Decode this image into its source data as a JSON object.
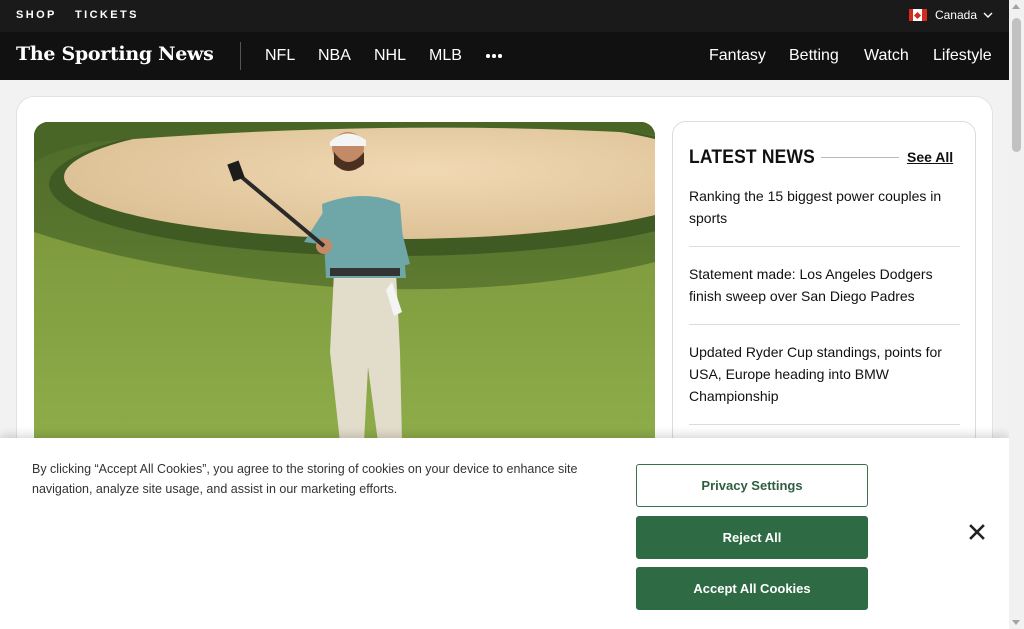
{
  "topbar": {
    "links": [
      "SHOP",
      "TICKETS"
    ],
    "region": "Canada"
  },
  "nav": {
    "logo": "The Sporting News",
    "leagues": [
      "NFL",
      "NBA",
      "NHL",
      "MLB"
    ],
    "sections": [
      "Fantasy",
      "Betting",
      "Watch",
      "Lifestyle"
    ]
  },
  "latest": {
    "title": "LATEST NEWS",
    "see_all": "See All",
    "items": [
      "Ranking the 15 biggest power couples in sports",
      "Statement made: Los Angeles Dodgers finish sweep over San Diego Padres",
      "Updated Ryder Cup standings, points for USA, Europe heading into BMW Championship"
    ]
  },
  "cookie": {
    "text": "By clicking “Accept All Cookies”, you agree to the storing of cookies on your device to enhance site navigation, analyze site usage, and assist in our marketing efforts.",
    "privacy_settings": "Privacy Settings",
    "reject_all": "Reject All",
    "accept_all": "Accept All Cookies"
  },
  "colors": {
    "header": "#1a1a1a",
    "nav": "#111111",
    "cookie_button": "#2e6b44"
  }
}
